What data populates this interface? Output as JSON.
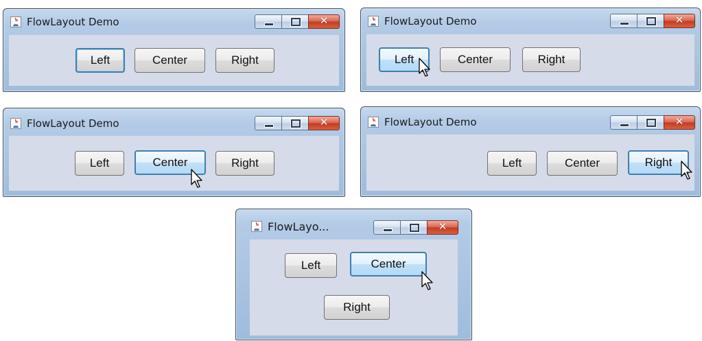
{
  "windows": [
    {
      "title": "FlowLayout Demo",
      "buttons": [
        {
          "label": "Left",
          "state": "focused"
        },
        {
          "label": "Center",
          "state": "normal"
        },
        {
          "label": "Right",
          "state": "normal"
        }
      ]
    },
    {
      "title": "FlowLayout Demo",
      "buttons": [
        {
          "label": "Left",
          "state": "hover-pressed"
        },
        {
          "label": "Center",
          "state": "normal"
        },
        {
          "label": "Right",
          "state": "normal"
        }
      ]
    },
    {
      "title": "FlowLayout Demo",
      "buttons": [
        {
          "label": "Left",
          "state": "normal"
        },
        {
          "label": "Center",
          "state": "hover-pressed"
        },
        {
          "label": "Right",
          "state": "normal"
        }
      ]
    },
    {
      "title": "FlowLayout Demo",
      "buttons": [
        {
          "label": "Left",
          "state": "normal"
        },
        {
          "label": "Center",
          "state": "normal"
        },
        {
          "label": "Right",
          "state": "hover-pressed"
        }
      ]
    },
    {
      "title": "FlowLayo...",
      "buttons": [
        {
          "label": "Left",
          "state": "normal"
        },
        {
          "label": "Center",
          "state": "hover-pressed"
        },
        {
          "label": "Right",
          "state": "normal"
        }
      ]
    }
  ],
  "icons": {
    "app": "java-app-icon",
    "minimize": "minimize-icon",
    "maximize": "maximize-icon",
    "close": "close-icon",
    "cursor": "mouse-pointer-icon"
  },
  "colors": {
    "title_bar": "#b3cbe6",
    "content_bg": "#d6dbe9",
    "close_button": "#c23b21",
    "focus_border": "#3c7fb1"
  }
}
